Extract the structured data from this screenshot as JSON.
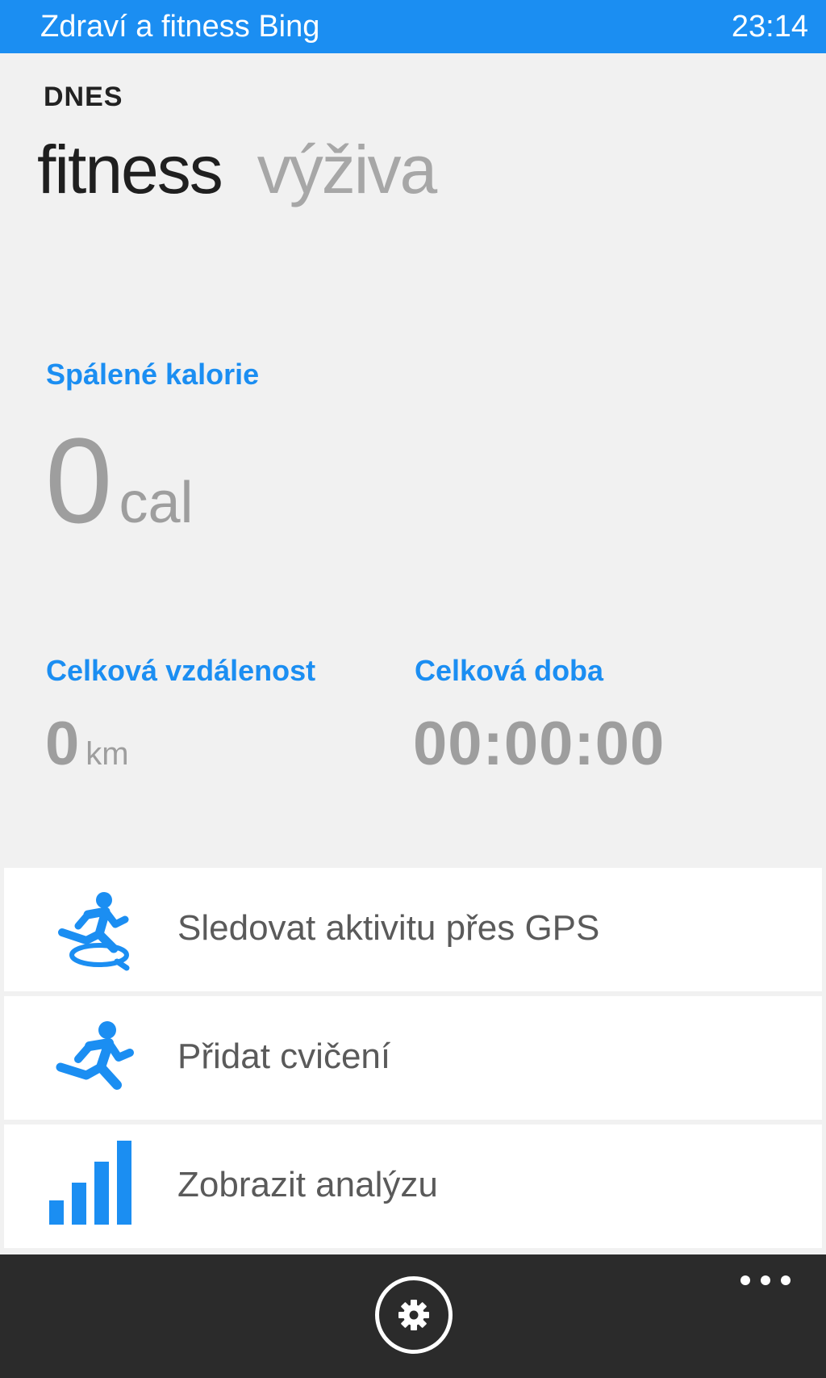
{
  "status_bar": {
    "app_title": "Zdraví a fitness Bing",
    "time": "23:14"
  },
  "header": {
    "section": "DNES",
    "pivots": [
      {
        "label": "fitness",
        "active": true
      },
      {
        "label": "výživa",
        "active": false
      }
    ]
  },
  "stats": {
    "calories": {
      "label": "Spálené kalorie",
      "value": "0",
      "unit": "cal"
    },
    "distance": {
      "label": "Celková vzdálenost",
      "value": "0",
      "unit": "km"
    },
    "duration": {
      "label": "Celková doba",
      "value": "00:00:00"
    }
  },
  "actions": [
    {
      "label": "Sledovat aktivitu přes GPS",
      "icon": "gps-runner-icon"
    },
    {
      "label": "Přidat cvičení",
      "icon": "runner-icon"
    },
    {
      "label": "Zobrazit analýzu",
      "icon": "bar-chart-icon"
    }
  ],
  "app_bar": {
    "buttons": [
      {
        "icon": "settings-gear-icon"
      },
      {
        "icon": "more-ellipsis-icon"
      }
    ]
  },
  "colors": {
    "accent": "#1b8ef2",
    "background": "#f1f1f1",
    "app_bar": "#2b2b2b",
    "value_gray": "#9e9e9e"
  }
}
